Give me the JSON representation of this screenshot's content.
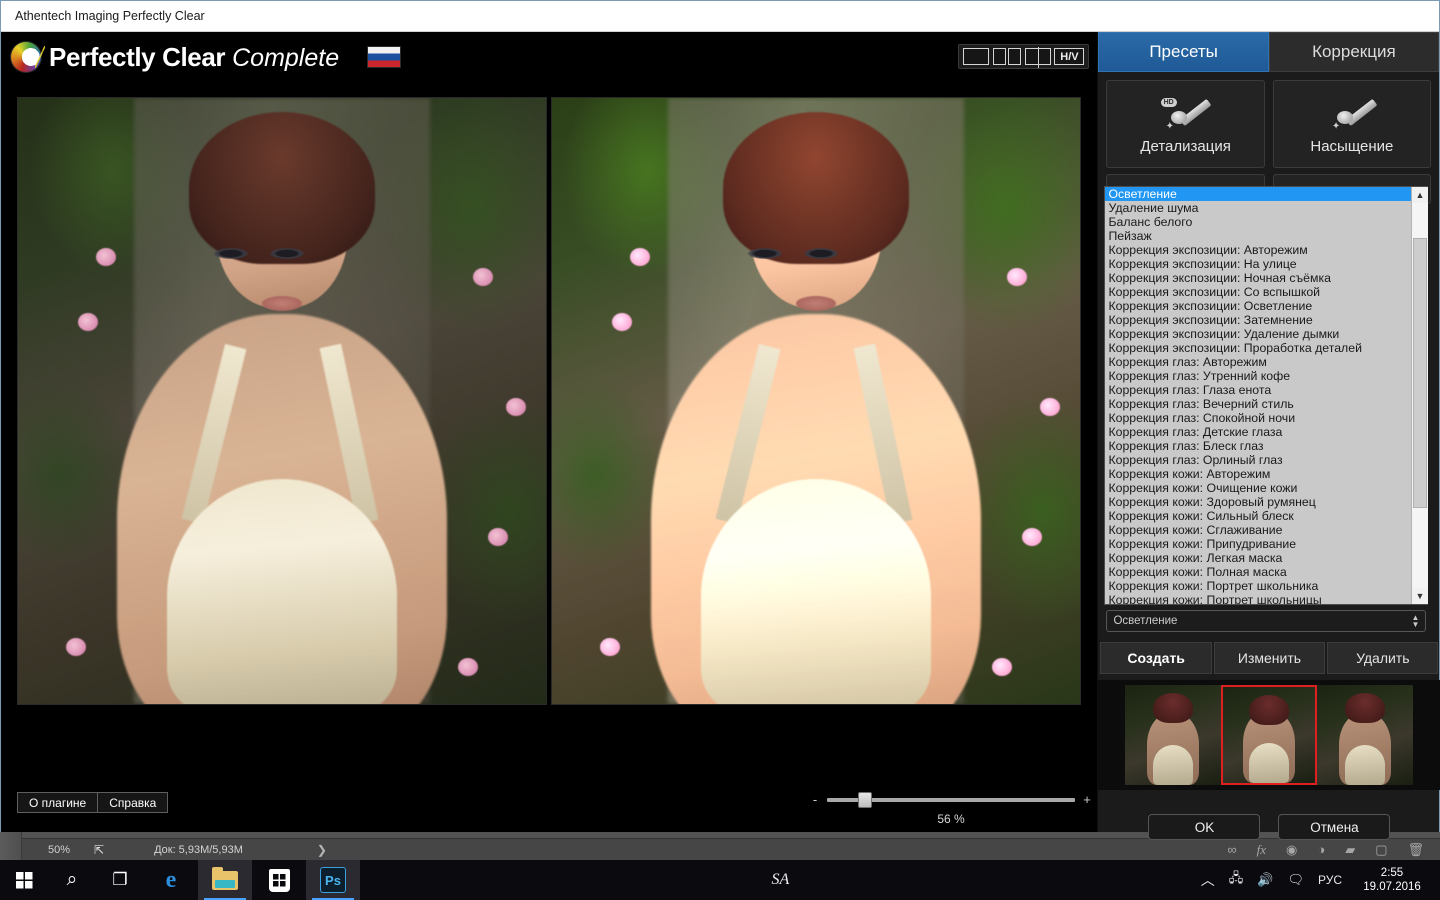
{
  "window": {
    "title": "Athentech Imaging Perfectly Clear"
  },
  "header": {
    "brand_bold": "Perfectly Clear",
    "brand_italic": "Complete",
    "flag": "ru-flag-icon",
    "logo": "perfectly-clear-logo-icon",
    "view_modes": [
      {
        "name": "single-view",
        "label": ""
      },
      {
        "name": "side-by-side-view",
        "label": ""
      },
      {
        "name": "split-view",
        "label": ""
      },
      {
        "name": "horizontal-vertical-toggle",
        "label": "H/V"
      }
    ]
  },
  "footer": {
    "about_label": "О плагине",
    "help_label": "Справка",
    "zoom_minus": "-",
    "zoom_plus": "+",
    "zoom_percent": "56 %",
    "zoom_value": 56
  },
  "panel": {
    "tabs": [
      {
        "label": "Пресеты",
        "active": true
      },
      {
        "label": "Коррекция",
        "active": false
      }
    ],
    "tiles": [
      {
        "label": "Детализация",
        "icon": "brush-hd-icon",
        "badge": "HD"
      },
      {
        "label": "Насыщение",
        "icon": "brush-icon",
        "badge": ""
      }
    ],
    "preset_list": [
      "Осветление",
      "Удаление шума",
      "Баланс белого",
      "Пейзаж",
      "Коррекция экспозиции: Авторежим",
      "Коррекция экспозиции: На улице",
      "Коррекция экспозиции: Ночная съёмка",
      "Коррекция экспозиции: Со вспышкой",
      "Коррекция экспозиции: Осветление",
      "Коррекция экспозиции: Затемнение",
      "Коррекция экспозиции: Удаление дымки",
      "Коррекция экспозиции: Проработка деталей",
      "Коррекция глаз: Авторежим",
      "Коррекция глаз: Утренний кофе",
      "Коррекция глаз: Глаза енота",
      "Коррекция глаз: Вечерний стиль",
      "Коррекция глаз: Спокойной ночи",
      "Коррекция глаз: Детские глаза",
      "Коррекция глаз: Блеск глаз",
      "Коррекция глаз: Орлиный глаз",
      "Коррекция кожи: Авторежим",
      "Коррекция кожи: Очищение кожи",
      "Коррекция кожи: Здоровый румянец",
      "Коррекция кожи: Сильный блеск",
      "Коррекция кожи: Сглаживание",
      "Коррекция кожи: Припудривание",
      "Коррекция кожи: Легкая маска",
      "Коррекция кожи: Полная маска",
      "Коррекция кожи: Портрет школьника",
      "Коррекция кожи: Портрет школьницы"
    ],
    "selected_preset": "Осветление",
    "dropdown_value": "Осветление",
    "actions": [
      {
        "label": "Создать",
        "primary": true
      },
      {
        "label": "Изменить",
        "primary": false
      },
      {
        "label": "Удалить",
        "primary": false
      }
    ],
    "confirm": {
      "ok_label": "OK",
      "cancel_label": "Отмена"
    }
  },
  "photoshop": {
    "zoom": "50%",
    "doc_info": "Док: 5,93M/5,93M",
    "share_icon": "share-icon",
    "expand_icon": "chevron-right-icon",
    "layer_icons": [
      "link-icon",
      "fx-icon",
      "adjustment-mask-icon",
      "adjustment-layer-icon",
      "new-group-icon",
      "new-layer-icon",
      "delete-layer-icon"
    ],
    "layer_icon_glyphs": [
      "∞",
      "fx",
      "◕",
      "◑",
      "▰",
      "▢",
      "🗑"
    ]
  },
  "taskbar": {
    "items": [
      {
        "name": "start-button",
        "glyph": ""
      },
      {
        "name": "search-icon",
        "glyph": "⌕"
      },
      {
        "name": "task-view-icon",
        "glyph": "⎘"
      },
      {
        "name": "edge-icon",
        "glyph": "e"
      },
      {
        "name": "file-explorer-icon",
        "glyph": ""
      },
      {
        "name": "microsoft-store-icon",
        "glyph": ""
      },
      {
        "name": "photoshop-icon",
        "glyph": "Ps"
      }
    ],
    "watermark": "SA",
    "tray": {
      "show_hidden": "⌃",
      "network_icon": "network-icon",
      "volume_icon": "volume-icon",
      "action_center_icon": "action-center-icon",
      "language": "РУС",
      "time": "2:55",
      "date": "19.07.2016"
    }
  },
  "colors": {
    "accent_blue": "#2196f3",
    "tab_active": "#2a6aa8",
    "panel_bg": "#1b1b1b",
    "selection_red": "#e02020"
  }
}
